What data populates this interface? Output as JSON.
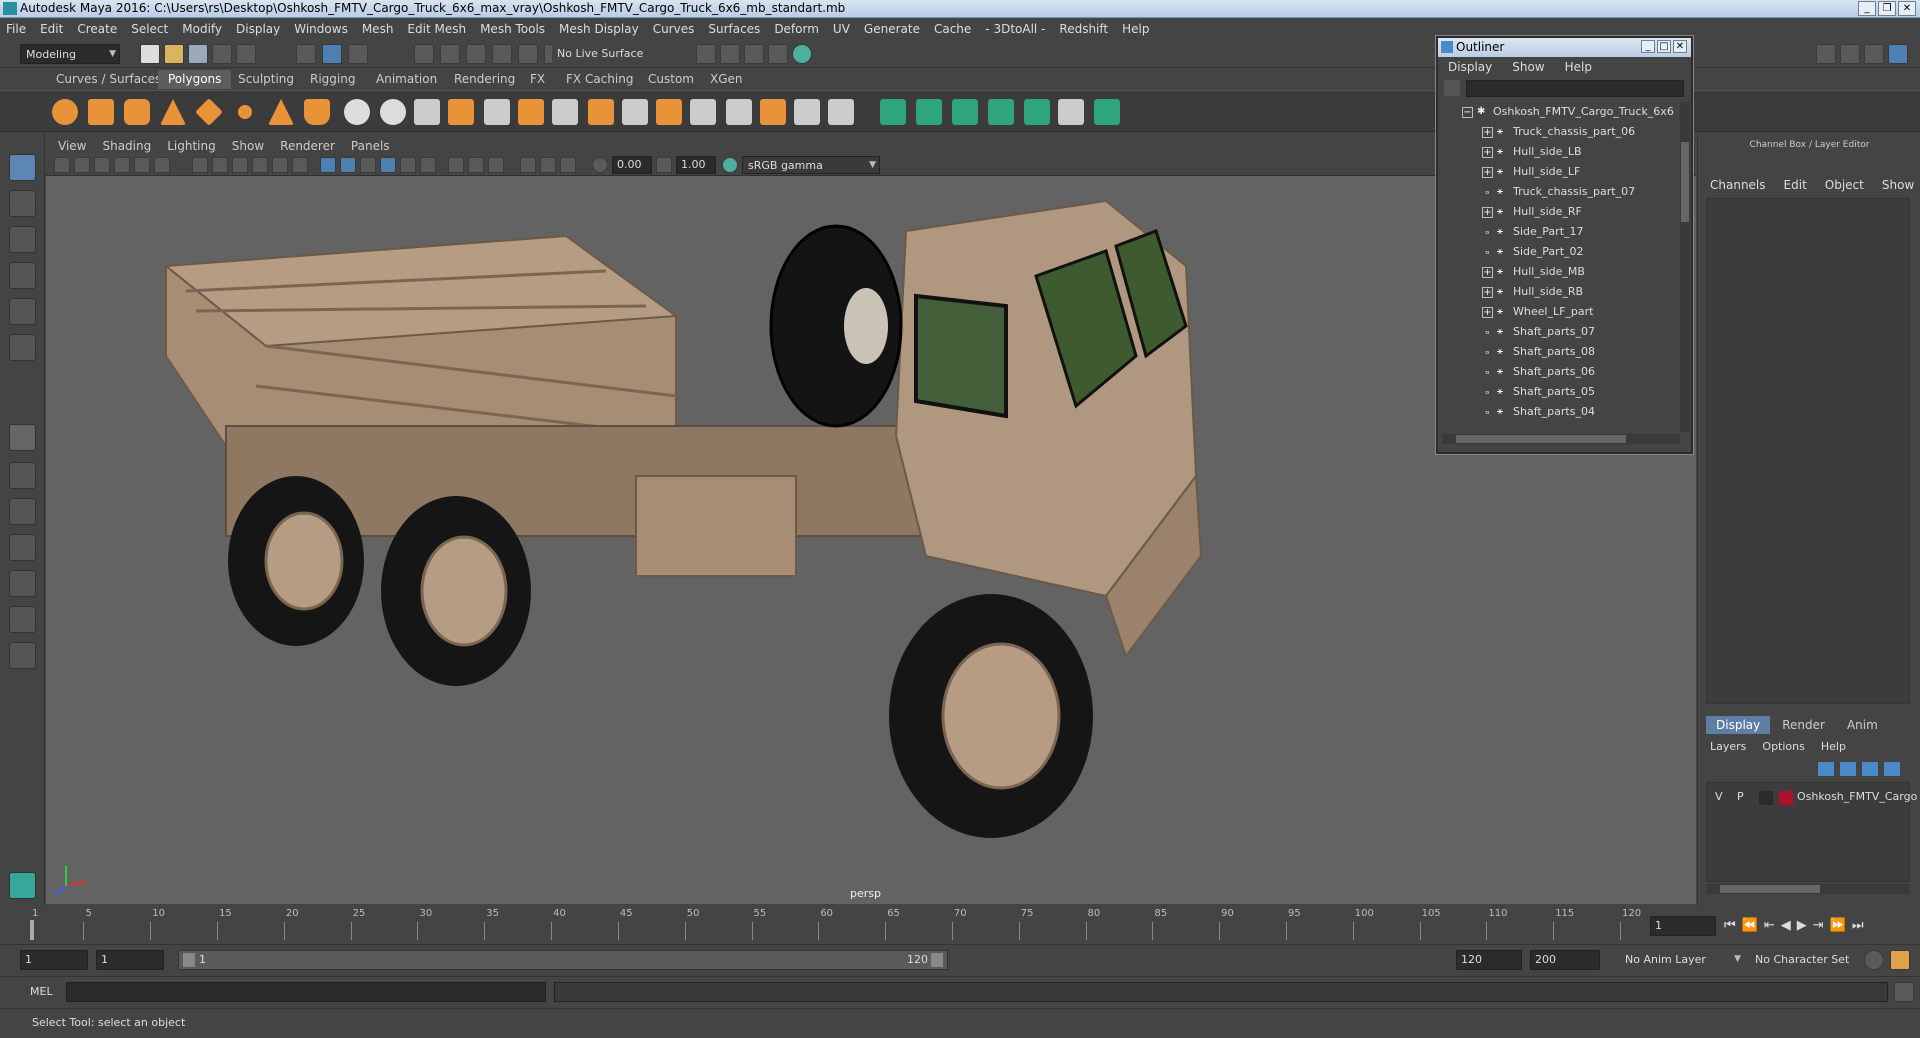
{
  "window": {
    "title": "Autodesk Maya 2016: C:\\Users\\rs\\Desktop\\Oshkosh_FMTV_Cargo_Truck_6x6_max_vray\\Oshkosh_FMTV_Cargo_Truck_6x6_mb_standart.mb"
  },
  "menubar": [
    "File",
    "Edit",
    "Create",
    "Select",
    "Modify",
    "Display",
    "Windows",
    "Mesh",
    "Edit Mesh",
    "Mesh Tools",
    "Mesh Display",
    "Curves",
    "Surfaces",
    "Deform",
    "UV",
    "Generate",
    "Cache",
    "- 3DtoAll -",
    "Redshift",
    "Help"
  ],
  "statusline": {
    "mode": "Modeling",
    "live_surface": "No Live Surface"
  },
  "shelf_tabs": [
    "Curves / Surfaces",
    "Polygons",
    "Sculpting",
    "Rigging",
    "Animation",
    "Rendering",
    "FX",
    "FX Caching",
    "Custom",
    "XGen"
  ],
  "active_shelf_tab": "Polygons",
  "viewport": {
    "menu": [
      "View",
      "Shading",
      "Lighting",
      "Show",
      "Renderer",
      "Panels"
    ],
    "field1": "0.00",
    "field2": "1.00",
    "color_space": "sRGB gamma",
    "camera_label": "persp"
  },
  "outliner": {
    "title": "Outliner",
    "menu": [
      "Display",
      "Show",
      "Help"
    ],
    "items": [
      {
        "label": "Oshkosh_FMTV_Cargo_Truck_6x6",
        "expander": "−",
        "level": 0
      },
      {
        "label": "Truck_chassis_part_06",
        "expander": "+",
        "level": 1
      },
      {
        "label": "Hull_side_LB",
        "expander": "+",
        "level": 1
      },
      {
        "label": "Hull_side_LF",
        "expander": "+",
        "level": 1
      },
      {
        "label": "Truck_chassis_part_07",
        "expander": "",
        "level": 1
      },
      {
        "label": "Hull_side_RF",
        "expander": "+",
        "level": 1
      },
      {
        "label": "Side_Part_17",
        "expander": "",
        "level": 1
      },
      {
        "label": "Side_Part_02",
        "expander": "",
        "level": 1
      },
      {
        "label": "Hull_side_MB",
        "expander": "+",
        "level": 1
      },
      {
        "label": "Hull_side_RB",
        "expander": "+",
        "level": 1
      },
      {
        "label": "Wheel_LF_part",
        "expander": "+",
        "level": 1
      },
      {
        "label": "Shaft_parts_07",
        "expander": "",
        "level": 1
      },
      {
        "label": "Shaft_parts_08",
        "expander": "",
        "level": 1
      },
      {
        "label": "Shaft_parts_06",
        "expander": "",
        "level": 1
      },
      {
        "label": "Shaft_parts_05",
        "expander": "",
        "level": 1
      },
      {
        "label": "Shaft_parts_04",
        "expander": "",
        "level": 1
      }
    ]
  },
  "channelbox": {
    "title": "Channel Box / Layer Editor",
    "menu": [
      "Channels",
      "Edit",
      "Object",
      "Show"
    ],
    "layer_tabs": [
      "Display",
      "Render",
      "Anim"
    ],
    "layer_menu": [
      "Layers",
      "Options",
      "Help"
    ],
    "layer": {
      "v": "V",
      "p": "P",
      "name": "Oshkosh_FMTV_Cargo",
      "color": "#b0102a"
    }
  },
  "timeline": {
    "ticks": [
      "1",
      "5",
      "10",
      "15",
      "20",
      "25",
      "30",
      "35",
      "40",
      "45",
      "50",
      "55",
      "60",
      "65",
      "70",
      "75",
      "80",
      "85",
      "90",
      "95",
      "100",
      "105",
      "110",
      "115",
      "120"
    ],
    "current_frame": "1"
  },
  "range": {
    "start": "1",
    "start2": "1",
    "slider_start": "1",
    "slider_end": "120",
    "end": "120",
    "end2": "200",
    "anim_layer": "No Anim Layer",
    "char_set": "No Character Set"
  },
  "mel": {
    "label": "MEL"
  },
  "helpline": "Select Tool: select an object"
}
